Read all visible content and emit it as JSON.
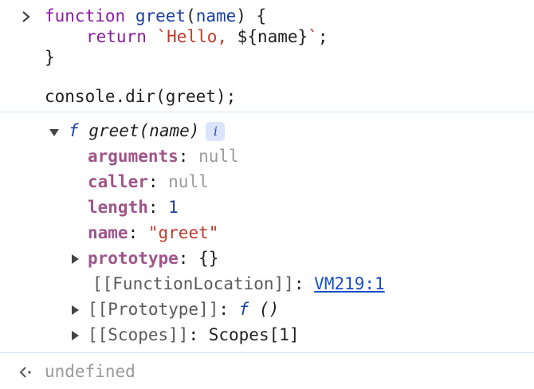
{
  "input": {
    "code_line1": {
      "keyword": "function",
      "name": "greet",
      "open_paren": "(",
      "param": "name",
      "close": ") {"
    },
    "code_line2": {
      "keyword": "return",
      "template": "`Hello, ",
      "expr": "${name}",
      "end_template": "`",
      "semicolon": ";"
    },
    "code_line3": "}",
    "code_line4": "console.dir(greet);"
  },
  "output": {
    "header": {
      "f_symbol": "f",
      "signature": "greet(name)",
      "info_badge": "i"
    },
    "properties": [
      {
        "key": "arguments",
        "sep": ": ",
        "value": "null",
        "type": "null"
      },
      {
        "key": "caller",
        "sep": ": ",
        "value": "null",
        "type": "null"
      },
      {
        "key": "length",
        "sep": ": ",
        "value": "1",
        "type": "number"
      },
      {
        "key": "name",
        "sep": ": ",
        "value": "\"greet\"",
        "type": "string"
      },
      {
        "key": "prototype",
        "sep": ": ",
        "value": "{}",
        "type": "object"
      }
    ],
    "function_location": {
      "key": "[[FunctionLocation]]",
      "sep": ": ",
      "value": "VM219:1"
    },
    "prototype_internal": {
      "key": "[[Prototype]]",
      "sep": ": ",
      "f_symbol": "f",
      "value": " ()"
    },
    "scopes": {
      "key": "[[Scopes]]",
      "sep": ": ",
      "value": "Scopes[1]"
    }
  },
  "result": {
    "value": "undefined"
  },
  "colors": {
    "keyword": "#8a1c9e",
    "function_name": "#1a3f9e",
    "string": "#c0392b",
    "property_key": "#a0558a",
    "null_value": "#9a9a9a",
    "link": "#1a4fc4",
    "separator": "#d6e2f0"
  }
}
